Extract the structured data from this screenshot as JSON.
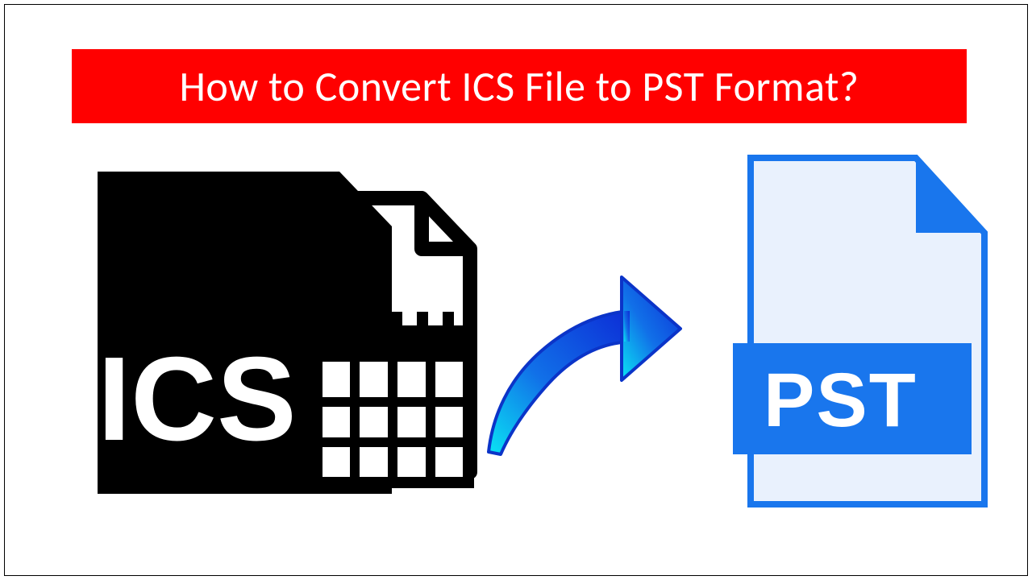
{
  "headline": {
    "text": "How to Convert ICS File to PST Format?"
  },
  "source_file": {
    "label": "ICS",
    "color": "#000000"
  },
  "target_file": {
    "label": "PST",
    "color": "#1976ED"
  },
  "arrow": {
    "gradient_start": "#0AE4F4",
    "gradient_end": "#0C2CD6"
  },
  "banner_color": "#ff0000"
}
